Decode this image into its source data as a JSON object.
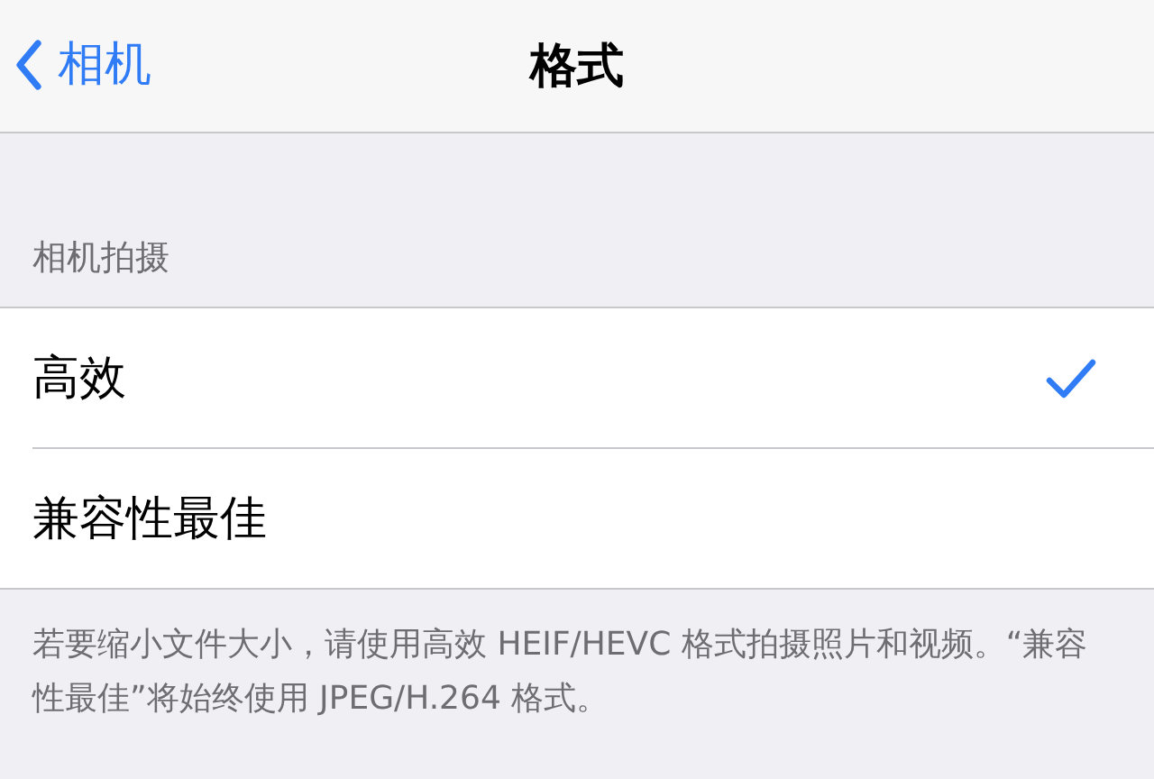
{
  "nav_bar": {
    "back_label": "相机",
    "title": "格式"
  },
  "section": {
    "header": "相机拍摄",
    "options": [
      {
        "label": "高效",
        "selected": true
      },
      {
        "label": "兼容性最佳",
        "selected": false
      }
    ],
    "footer": "若要缩小文件大小，请使用高效 HEIF/HEVC 格式拍摄照片和视频。“兼容性最佳”将始终使用 JPEG/H.264 格式。"
  }
}
